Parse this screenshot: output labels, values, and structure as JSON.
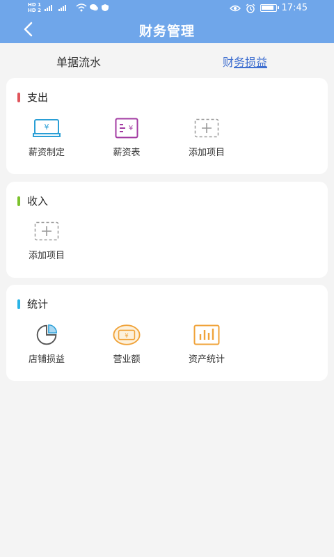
{
  "status_bar": {
    "time": "17:45",
    "left_indicators": [
      "HD 1",
      "HD 2"
    ]
  },
  "header": {
    "title": "财务管理"
  },
  "tabs": [
    {
      "label": "单据流水",
      "active": false
    },
    {
      "label": "财务损益",
      "active": true
    }
  ],
  "sections": [
    {
      "title": "支出",
      "accent": "#e0545b",
      "items": [
        {
          "label": "薪资制定",
          "icon": "salary-setting-icon"
        },
        {
          "label": "薪资表",
          "icon": "salary-table-icon"
        },
        {
          "label": "添加项目",
          "icon": "add-item-icon"
        }
      ]
    },
    {
      "title": "收入",
      "accent": "#7cc22d",
      "items": [
        {
          "label": "添加项目",
          "icon": "add-item-icon"
        }
      ]
    },
    {
      "title": "统计",
      "accent": "#2ab4e6",
      "items": [
        {
          "label": "店铺损益",
          "icon": "pie-chart-icon"
        },
        {
          "label": "营业额",
          "icon": "revenue-icon"
        },
        {
          "label": "资产统计",
          "icon": "bar-chart-icon"
        }
      ]
    }
  ],
  "colors": {
    "header": "#6fa6ea",
    "active_tab": "#3f6fd0",
    "background": "#f4f4f4"
  }
}
